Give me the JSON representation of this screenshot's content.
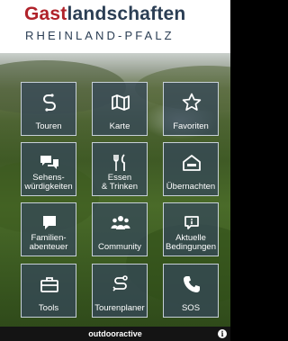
{
  "header": {
    "title_part1": "Gast",
    "title_part2": "landschaften",
    "subtitle": "RHEINLAND-PFALZ"
  },
  "colors": {
    "brand_red": "#b0222a",
    "brand_navy": "#2b3e54",
    "tile_bg": "#35465c"
  },
  "tiles": [
    {
      "label": "Touren",
      "icon": "route-s-icon"
    },
    {
      "label": "Karte",
      "icon": "map-icon"
    },
    {
      "label": "Favoriten",
      "icon": "star-icon"
    },
    {
      "label": "Sehens-\nwürdigkeiten",
      "icon": "speech-bubbles-icon"
    },
    {
      "label": "Essen\n& Trinken",
      "icon": "fork-knife-icon"
    },
    {
      "label": "Übernachten",
      "icon": "lodging-icon"
    },
    {
      "label": "Familien-\nabenteuer",
      "icon": "chat-bubble-icon"
    },
    {
      "label": "Community",
      "icon": "people-group-icon"
    },
    {
      "label": "Aktuelle\nBedingungen",
      "icon": "info-bubble-icon"
    },
    {
      "label": "Tools",
      "icon": "toolbox-icon"
    },
    {
      "label": "Tourenplaner",
      "icon": "route-planner-icon"
    },
    {
      "label": "SOS",
      "icon": "phone-icon"
    }
  ],
  "footer": {
    "label": "outdooractive",
    "info_icon": "info-icon"
  }
}
